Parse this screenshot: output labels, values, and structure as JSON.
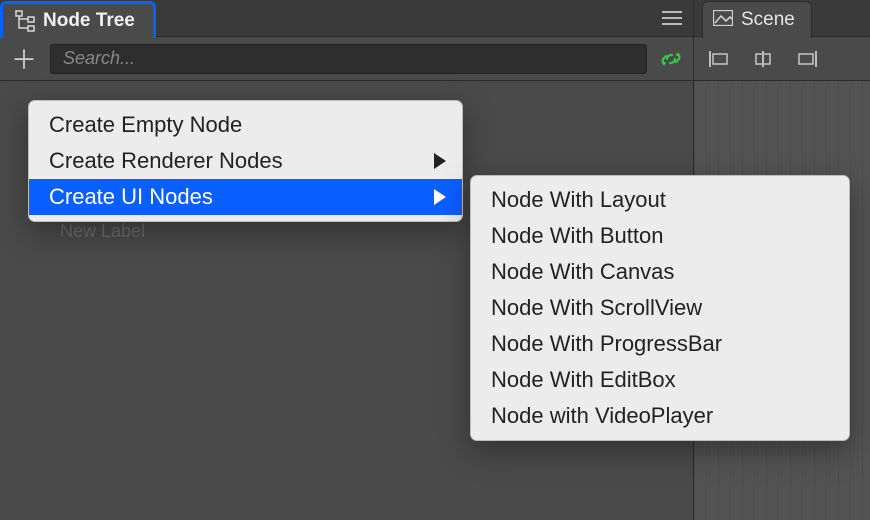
{
  "node_tree": {
    "tab_title": "Node Tree",
    "search_placeholder": "Search...",
    "ghost_item": "New Label"
  },
  "scene": {
    "tab_title": "Scene"
  },
  "context_menu": {
    "items": [
      {
        "label": "Create Empty Node",
        "has_sub": false,
        "selected": false
      },
      {
        "label": "Create Renderer Nodes",
        "has_sub": true,
        "selected": false
      },
      {
        "label": "Create UI Nodes",
        "has_sub": true,
        "selected": true
      }
    ]
  },
  "submenu": {
    "items": [
      {
        "label": "Node With Layout"
      },
      {
        "label": "Node With Button"
      },
      {
        "label": "Node With Canvas"
      },
      {
        "label": "Node With ScrollView"
      },
      {
        "label": "Node With ProgressBar"
      },
      {
        "label": "Node With EditBox"
      },
      {
        "label": "Node with VideoPlayer"
      }
    ]
  }
}
